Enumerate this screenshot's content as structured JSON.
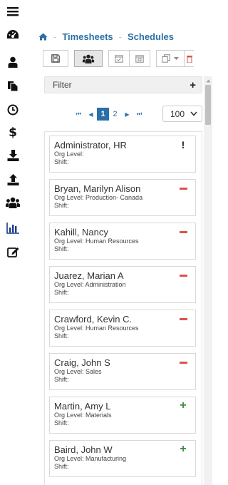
{
  "sidebar": {
    "items": [
      {
        "icon": "menu-icon"
      },
      {
        "icon": "dashboard-icon"
      },
      {
        "icon": "user-icon"
      },
      {
        "icon": "documents-icon"
      },
      {
        "icon": "clock-icon"
      },
      {
        "icon": "dollar-icon"
      },
      {
        "icon": "download-icon"
      },
      {
        "icon": "upload-icon"
      },
      {
        "icon": "users-icon"
      },
      {
        "icon": "bar-chart-icon"
      },
      {
        "icon": "edit-icon"
      }
    ]
  },
  "breadcrumb": {
    "items": [
      "Timesheets",
      "Schedules"
    ],
    "separator": "-"
  },
  "filter": {
    "label": "Filter",
    "add_symbol": "+"
  },
  "pager": {
    "first": "⏮",
    "prev": "◀",
    "pages": [
      "1",
      "2"
    ],
    "current": "1",
    "next": "▶",
    "last": "⏭"
  },
  "page_size": {
    "value": "100"
  },
  "colors": {
    "accent": "#2a6fa8",
    "remove": "#d9534f",
    "add": "#3c8c3c"
  },
  "employees": [
    {
      "name": "Administrator, HR",
      "org_level": "Org Level:",
      "shift": "Shift:",
      "action": "!",
      "action_type": "alert"
    },
    {
      "name": "Bryan, Marilyn Alison",
      "org_level": "Org Level: Production- Canada",
      "shift": "Shift:",
      "action": "−",
      "action_type": "remove"
    },
    {
      "name": "Kahill, Nancy",
      "org_level": "Org Level: Human Resources",
      "shift": "Shift:",
      "action": "−",
      "action_type": "remove"
    },
    {
      "name": "Juarez, Marian A",
      "org_level": "Org Level: Administration",
      "shift": "Shift:",
      "action": "−",
      "action_type": "remove"
    },
    {
      "name": "Crawford, Kevin C.",
      "org_level": "Org Level: Human Resources",
      "shift": "Shift:",
      "action": "−",
      "action_type": "remove"
    },
    {
      "name": "Craig, John S",
      "org_level": "Org Level: Sales",
      "shift": "Shift:",
      "action": "−",
      "action_type": "remove"
    },
    {
      "name": "Martin, Amy L",
      "org_level": "Org Level: Materials",
      "shift": "Shift:",
      "action": "+",
      "action_type": "add"
    },
    {
      "name": "Baird, John W",
      "org_level": "Org Level: Manufacturing",
      "shift": "Shift:",
      "action": "+",
      "action_type": "add"
    }
  ]
}
